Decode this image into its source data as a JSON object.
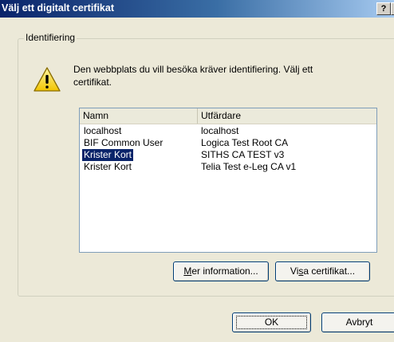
{
  "window": {
    "title": "Välj ett digitalt certifikat",
    "help_label": "?",
    "close_label": "×"
  },
  "group": {
    "label": "Identifiering"
  },
  "message": "Den webbplats du vill besöka kräver identifiering. Välj ett certifikat.",
  "list": {
    "headers": [
      "Namn",
      "Utfärdare"
    ],
    "rows": [
      {
        "name": "localhost",
        "issuer": "localhost",
        "selected": false
      },
      {
        "name": "BIF Common User",
        "issuer": "Logica Test Root CA",
        "selected": false
      },
      {
        "name": "Krister Kort",
        "issuer": "SITHS CA TEST v3",
        "selected": true
      },
      {
        "name": "Krister Kort",
        "issuer": "Telia Test e-Leg CA v1",
        "selected": false
      }
    ]
  },
  "buttons": {
    "more_info": {
      "label": "Mer information...",
      "mnemonic": "M"
    },
    "view_cert": {
      "label": "Visa certifikat...",
      "mnemonic": "s"
    },
    "ok": "OK",
    "cancel": "Avbryt"
  },
  "colors": {
    "selection": "#0a246a",
    "title_start": "#0a246a",
    "title_end": "#a6caf0",
    "dialog_bg": "#ece9d8"
  },
  "icons": {
    "warning": "warning-icon"
  }
}
